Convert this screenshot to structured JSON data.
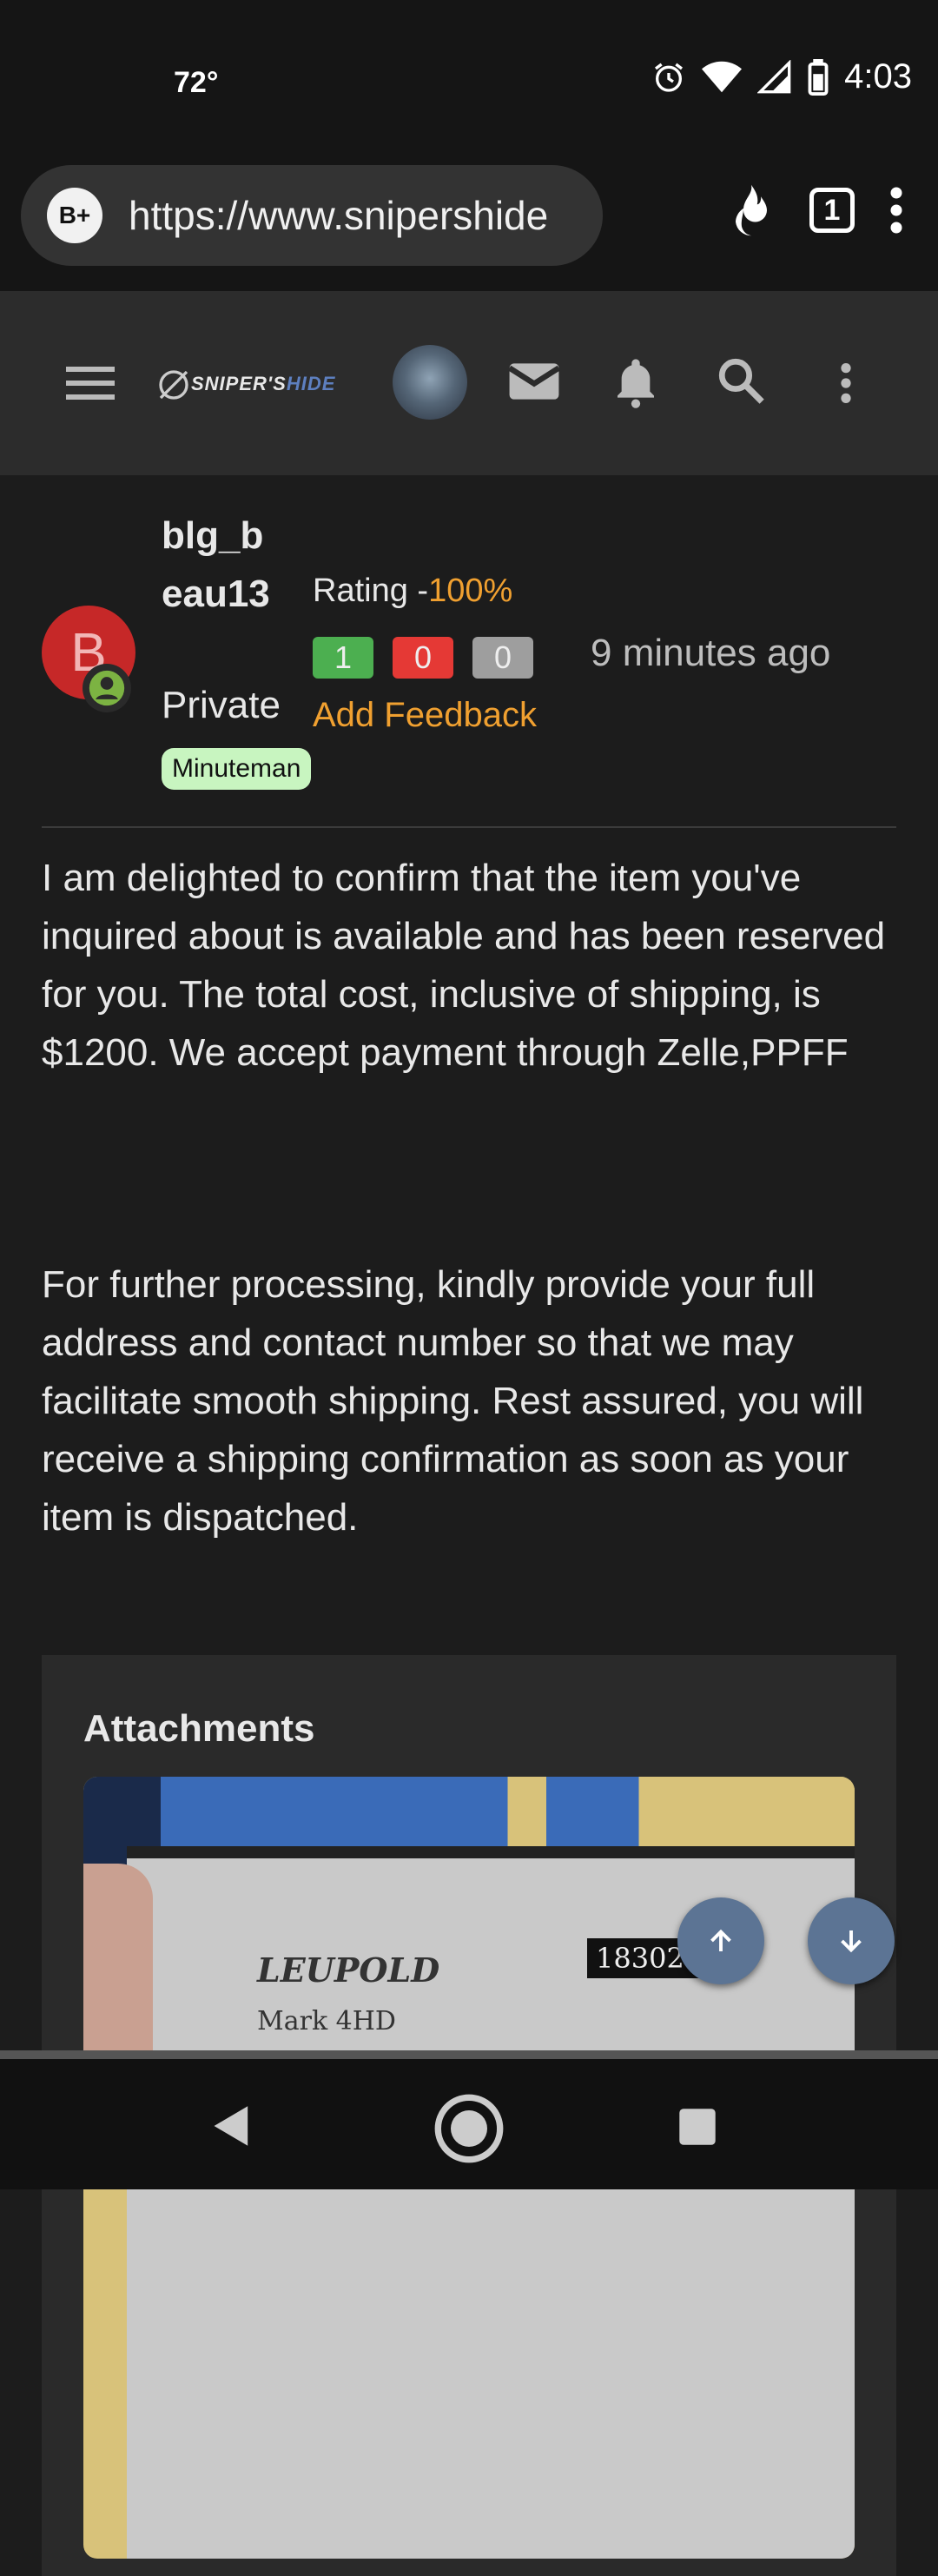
{
  "status_bar": {
    "temperature": "72°",
    "time": "4:03"
  },
  "browser": {
    "site_badge": "B+",
    "url": "https://www.snipershide",
    "tab_count": "1"
  },
  "site_header": {
    "logo_text": "SNIPER'S",
    "logo_accent": "HIDE"
  },
  "post": {
    "user": {
      "username": "blg_beau13",
      "avatar_letter": "B",
      "title": "Private",
      "banner": "Minuteman"
    },
    "rating_label": "Rating -",
    "rating_value": "100%",
    "feedback": {
      "positive": "1",
      "negative": "0",
      "neutral": "0"
    },
    "add_feedback": "Add Feedback",
    "time_ago": "9 minutes ago",
    "message": {
      "paragraph1": "I am delighted to confirm that the item you've inquired about is available and has been reserved for you. The total cost, inclusive of shipping, is $1200. We accept payment through Zelle,PPFF",
      "paragraph2": "For further processing, kindly provide your full address and contact number so that we may facilitate smooth shipping. Rest assured, you will receive a shipping confirmation as soon as your item is dispatched."
    },
    "attachments": {
      "title": "Attachments",
      "thumbnail_text": {
        "brand": "LEUPOLD",
        "model": "Mark 4HD",
        "code": "183024"
      }
    }
  },
  "colors": {
    "accent_orange": "#f0a030",
    "positive": "#4caf50",
    "negative": "#e53935",
    "neutral": "#9e9e9e"
  }
}
